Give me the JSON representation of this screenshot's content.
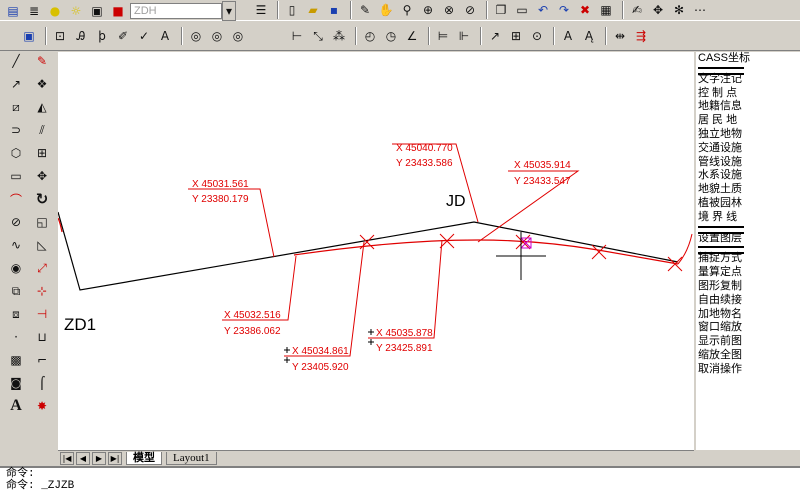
{
  "toolbar_top": {
    "layer_combo": "ZDH"
  },
  "icons": {
    "top_row1": [
      "layer-manager-icon",
      "layers-icon",
      "bulb-icon",
      "sun-icon",
      "lock-icon",
      "printer-icon",
      "color-swatch-icon"
    ],
    "top_row1_right": [
      "menu-icon",
      "new-file-icon",
      "open-folder-icon",
      "save-icon",
      "pencil-icon",
      "hand-pan-icon",
      "zoom-realtime-icon",
      "zoom-window-icon",
      "zoom-all-icon",
      "zoom-prev-icon",
      "copy-icon",
      "paste-icon",
      "undo-icon",
      "redo-icon",
      "eraser-icon",
      "properties-icon",
      "grid-icon",
      "draw-point-icon",
      "move-icon",
      "rotate-icon"
    ]
  },
  "left_toolbar_a": [
    "line-icon",
    "polyline-icon",
    "rectangle-draw-icon",
    "arc-icon",
    "circle-icon",
    "polygon-icon",
    "rectangle-icon",
    "spline-icon",
    "circle-tool-icon",
    "curve-icon",
    "ellipse-icon",
    "hatch-icon",
    "region-icon",
    "point-icon",
    "table-icon",
    "region-fill-icon",
    "text-icon"
  ],
  "left_toolbar_b": [
    "erase-icon",
    "copy-object-icon",
    "mirror-icon",
    "offset-icon",
    "array-icon",
    "move-object-icon",
    "rotate-object-icon",
    "scale-icon",
    "stretch-icon",
    "trim-icon",
    "extend-icon",
    "break-icon",
    "chamfer-icon",
    "fillet-icon",
    "explode-icon"
  ],
  "side_menu": {
    "items": [
      "CASS坐标",
      "",
      "文字注记",
      "控 制 点",
      "地籍信息",
      "居 民 地",
      "独立地物",
      "交通设施",
      "管线设施",
      "水系设施",
      "地貌土质",
      "植被园林",
      "境 界 线",
      "",
      "设置图层",
      "",
      "捕捉方式",
      "量算定点",
      "图形复制",
      "自由续接",
      "加地物名",
      "窗口缩放",
      "显示前图",
      "缩放全图",
      "取消操作"
    ]
  },
  "drawing": {
    "labels": {
      "zd1": "ZD1",
      "jd": "JD"
    },
    "coords": [
      {
        "x": "X 45031.561",
        "y": "Y 23380.179"
      },
      {
        "x": "X 45040.770",
        "y": "Y 23433.586"
      },
      {
        "x": "X 45035.914",
        "y": "Y 23433.547"
      },
      {
        "x": "X 45032.516",
        "y": "Y 23386.062"
      },
      {
        "x": "X 45034.861",
        "y": "Y 23405.920"
      },
      {
        "x": "X 45035.878",
        "y": "Y 23425.891"
      }
    ]
  },
  "tabs": {
    "model": "模型",
    "layout1": "Layout1"
  },
  "command": {
    "line1": "命令:",
    "line2": "命令: _ZJZB"
  }
}
